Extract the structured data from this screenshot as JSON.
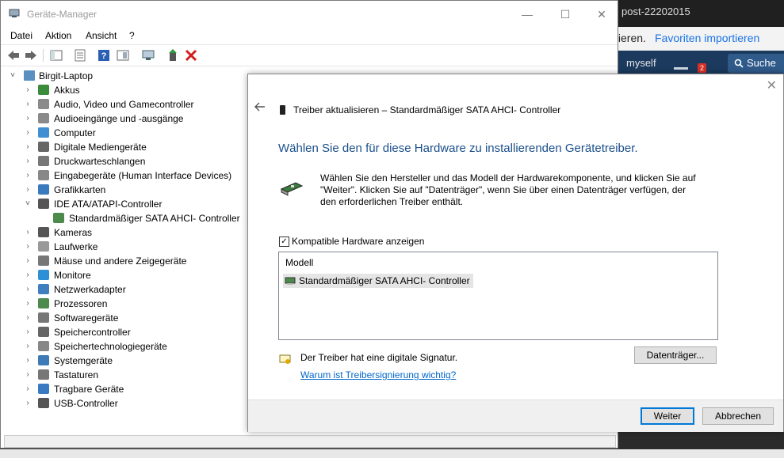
{
  "background": {
    "browser_tab": "post-22202015",
    "fav_text": "tieren.",
    "fav_link": "Favoriten importieren",
    "nav_user": "myself",
    "nav_badge": "2",
    "nav_search": "Suche"
  },
  "device_manager": {
    "title": "Geräte-Manager",
    "window_buttons": {
      "minimize": "—",
      "maximize": "☐",
      "close": "✕"
    },
    "menu": [
      "Datei",
      "Aktion",
      "Ansicht",
      "?"
    ],
    "tree_root": "Birgit-Laptop",
    "tree": [
      {
        "label": "Akkus",
        "icon": "battery-icon"
      },
      {
        "label": "Audio, Video und Gamecontroller",
        "icon": "speaker-icon"
      },
      {
        "label": "Audioeingänge und -ausgänge",
        "icon": "speaker-icon"
      },
      {
        "label": "Computer",
        "icon": "computer-icon"
      },
      {
        "label": "Digitale Mediengeräte",
        "icon": "media-device-icon"
      },
      {
        "label": "Druckwarteschlangen",
        "icon": "printer-icon"
      },
      {
        "label": "Eingabegeräte (Human Interface Devices)",
        "icon": "hid-icon"
      },
      {
        "label": "Grafikkarten",
        "icon": "display-adapter-icon"
      },
      {
        "label": "IDE ATA/ATAPI-Controller",
        "icon": "ide-controller-icon",
        "expanded": true
      },
      {
        "label": "Standardmäßiger SATA AHCI- Controller",
        "icon": "controller-card-icon",
        "child": true
      },
      {
        "label": "Kameras",
        "icon": "camera-icon"
      },
      {
        "label": "Laufwerke",
        "icon": "drive-icon"
      },
      {
        "label": "Mäuse und andere Zeigegeräte",
        "icon": "mouse-icon"
      },
      {
        "label": "Monitore",
        "icon": "monitor-icon"
      },
      {
        "label": "Netzwerkadapter",
        "icon": "network-icon"
      },
      {
        "label": "Prozessoren",
        "icon": "processor-icon"
      },
      {
        "label": "Softwaregeräte",
        "icon": "software-device-icon"
      },
      {
        "label": "Speichercontroller",
        "icon": "storage-controller-icon"
      },
      {
        "label": "Speichertechnologiegeräte",
        "icon": "storage-tech-icon"
      },
      {
        "label": "Systemgeräte",
        "icon": "system-device-icon"
      },
      {
        "label": "Tastaturen",
        "icon": "keyboard-icon"
      },
      {
        "label": "Tragbare Geräte",
        "icon": "portable-device-icon"
      },
      {
        "label": "USB-Controller",
        "icon": "usb-icon"
      }
    ]
  },
  "wizard": {
    "close": "✕",
    "header": "Treiber aktualisieren – Standardmäßiger SATA AHCI- Controller",
    "heading": "Wählen Sie den für diese Hardware zu installierenden Gerätetreiber.",
    "intro": "Wählen Sie den Hersteller und das Modell der Hardwarekomponente, und klicken Sie auf \"Weiter\". Klicken Sie auf \"Datenträger\", wenn Sie über einen Datenträger verfügen, der den erforderlichen Treiber enthält.",
    "compatible_checkbox": "Kompatible Hardware anzeigen",
    "compatible_checked": true,
    "list_header": "Modell",
    "list_item": "Standardmäßiger SATA AHCI- Controller",
    "signature_text": "Der Treiber hat eine digitale Signatur.",
    "signature_link": "Warum ist Treibersignierung wichtig?",
    "btn_disk": "Datenträger...",
    "btn_next": "Weiter",
    "btn_cancel": "Abbrechen"
  }
}
